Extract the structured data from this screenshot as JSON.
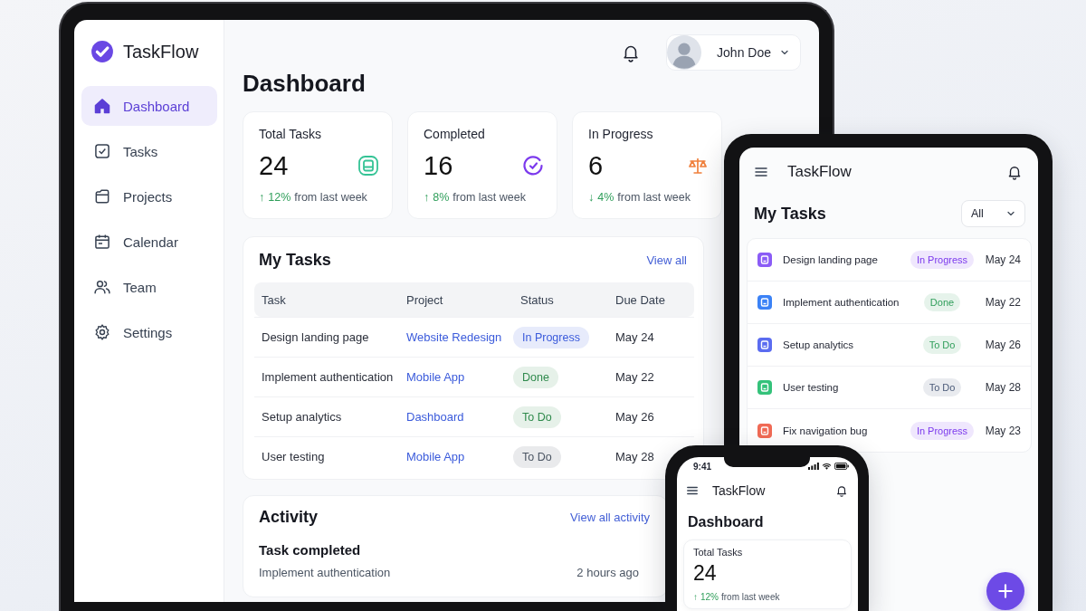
{
  "laptop": {
    "sidebar": {
      "logo": "TaskFlow",
      "items": [
        {
          "label": "Dashboard",
          "selected": true
        },
        {
          "label": "Tasks",
          "selected": false
        },
        {
          "label": "Projects",
          "selected": false
        },
        {
          "label": "Calendar",
          "selected": false
        },
        {
          "label": "Team",
          "selected": false
        },
        {
          "label": "Settings",
          "selected": false
        }
      ]
    },
    "header": {
      "user_name": "John Doe"
    },
    "title": "Dashboard",
    "stats": [
      {
        "label": "Total Tasks",
        "value": "24",
        "color": "#34c395",
        "arrow": "↑",
        "change": "12%",
        "note": "from last week"
      },
      {
        "label": "Completed",
        "value": "16",
        "color": "#7c3aed",
        "arrow": "↑",
        "change": "8%",
        "note": "from last week"
      },
      {
        "label": "In Progress",
        "value": "6",
        "color": "#f0803c",
        "arrow": "↓",
        "change": "4%",
        "note": "from last week"
      }
    ],
    "tasks": {
      "title": "My Tasks",
      "link": "View all",
      "columns": [
        "Task",
        "Project",
        "Status",
        "Due Date"
      ],
      "rows": [
        {
          "task": "Design landing page",
          "project": "Website Redesign",
          "status": {
            "label": "In Progress",
            "color": "#3b5bdb"
          },
          "due": "May 24"
        },
        {
          "task": "Implement authentication",
          "project": "Mobile App",
          "status": {
            "label": "Done",
            "color": "#2f8a4c"
          },
          "due": "May 22"
        },
        {
          "task": "Setup analytics",
          "project": "Dashboard",
          "status": {
            "label": "To Do",
            "color": "#2f8a4c"
          },
          "due": "May 26"
        },
        {
          "task": "User testing",
          "project": "Mobile App",
          "status": {
            "label": "To Do",
            "color": "#4b5563"
          },
          "due": "May 28"
        }
      ]
    },
    "activity": {
      "title": "Activity",
      "link": "View all activity",
      "items": [
        {
          "title": "Task completed",
          "detail": "Implement authentication",
          "time": "2 hours ago"
        }
      ]
    }
  },
  "tablet": {
    "app_name": "TaskFlow",
    "title": "My Tasks",
    "filter": "All",
    "tasks": [
      {
        "name": "Design landing page",
        "color": "#8b5cf6",
        "status": {
          "label": "In Progress",
          "color": "#7c3aed"
        },
        "due": "May 24"
      },
      {
        "name": "Implement authentication",
        "color": "#3b82f6",
        "status": {
          "label": "Done",
          "color": "#2f9e5a"
        },
        "due": "May 22"
      },
      {
        "name": "Setup analytics",
        "color": "#5b6cf0",
        "status": {
          "label": "To Do",
          "color": "#2f9e5a"
        },
        "due": "May 26"
      },
      {
        "name": "User testing",
        "color": "#34c27a",
        "status": {
          "label": "To Do",
          "color": "#4a5a78"
        },
        "due": "May 28"
      },
      {
        "name": "Fix navigation bug",
        "color": "#f06a55",
        "status": {
          "label": "In Progress",
          "color": "#7c3aed"
        },
        "due": "May 23"
      }
    ]
  },
  "phone": {
    "time": "9:41",
    "app_name": "TaskFlow",
    "title": "Dashboard",
    "stat": {
      "label": "Total Tasks",
      "value": "24",
      "arrow": "↑",
      "change": "12%",
      "note": "from last week"
    }
  }
}
